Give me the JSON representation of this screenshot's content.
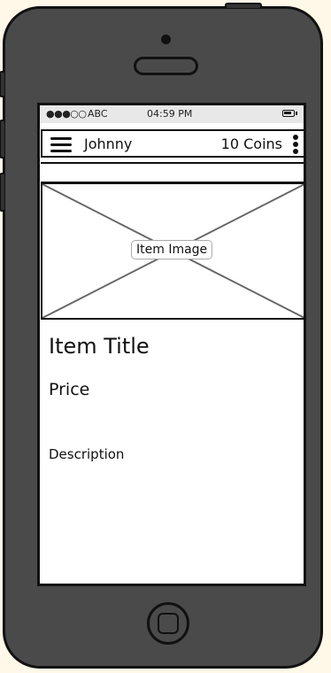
{
  "status_bar": {
    "signal": "●●●○○",
    "carrier": "ABC",
    "time": "04:59 PM",
    "battery_icon": "battery-icon"
  },
  "nav_bar": {
    "menu_icon": "hamburger-icon",
    "username": "Johnny",
    "coins": "10 Coins",
    "more_icon": "more-vertical-icon"
  },
  "item": {
    "image_label": "Item Image",
    "title": "Item Title",
    "price": "Price",
    "description": "Description"
  },
  "device": {
    "home_button_icon": "home-button-icon"
  },
  "colors": {
    "background": "#fff7e8",
    "phone_body": "#4a4a4a",
    "outline": "#111111",
    "status_bar": "#e8e8e8"
  }
}
